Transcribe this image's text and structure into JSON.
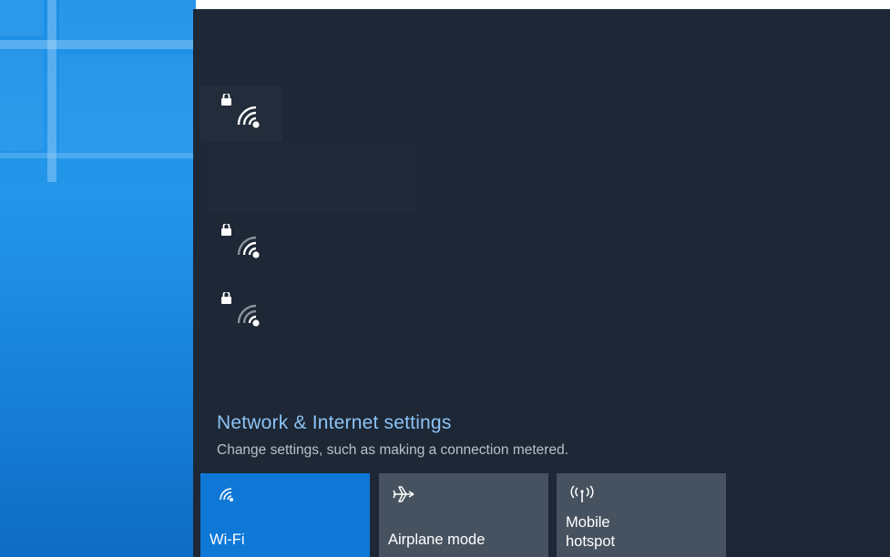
{
  "desktop": {
    "wallpaper": "windows-logo-wallpaper"
  },
  "networks": [
    {
      "icon": "wifi-secured-icon",
      "selected": true
    },
    {
      "icon": "wifi-secured-icon",
      "selected": false
    },
    {
      "icon": "wifi-secured-icon",
      "selected": false
    }
  ],
  "settings": {
    "link_label": "Network & Internet settings",
    "description": "Change settings, such as making a connection metered."
  },
  "quick_actions": [
    {
      "label": "Wi-Fi",
      "icon": "wifi-icon",
      "active": true
    },
    {
      "label": "Airplane mode",
      "icon": "airplane-icon",
      "active": false
    },
    {
      "label": "Mobile\nhotspot",
      "icon": "mobile-hotspot-icon",
      "active": false
    }
  ],
  "colors": {
    "flyout_bg": "#1d2735",
    "link": "#8cc3f5",
    "tile_active": "#0f78d7",
    "tile_inactive": "#475260"
  }
}
